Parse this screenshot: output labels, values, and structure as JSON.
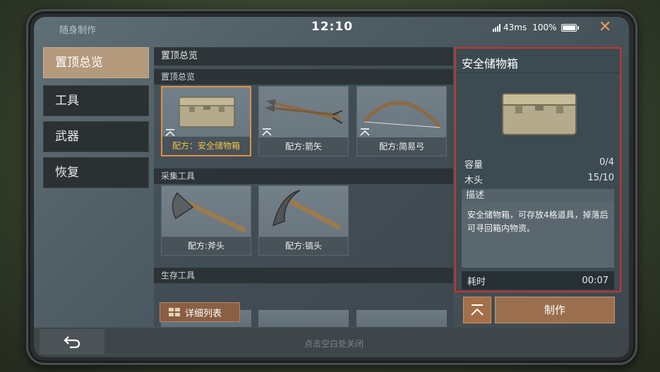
{
  "header": {
    "title": "随身制作",
    "clock": "12:10",
    "ping": "43ms",
    "battery": "100%",
    "close_icon": "close-icon"
  },
  "sidebar": {
    "items": [
      {
        "label": "置顶总览",
        "active": true
      },
      {
        "label": "工具"
      },
      {
        "label": "武器"
      },
      {
        "label": "恢复"
      }
    ]
  },
  "main": {
    "header": "置顶总览",
    "sections": [
      {
        "title": "置顶总览",
        "cards": [
          {
            "label": "配方：安全储物箱",
            "selected": true
          },
          {
            "label": "配方:箭矢"
          },
          {
            "label": "配方:简易弓"
          }
        ]
      },
      {
        "title": "采集工具",
        "cards": [
          {
            "label": "配方:斧头"
          },
          {
            "label": "配方:镐头"
          }
        ]
      },
      {
        "title": "生存工具"
      }
    ],
    "detail_list_button": "详细列表"
  },
  "detail": {
    "name": "安全储物箱",
    "capacity_label": "容量",
    "capacity_value": "0/4",
    "wood_label": "木头",
    "wood_value": "15/10",
    "desc_header": "描述",
    "desc_text": "安全储物箱，可存放4格道具，掉落后可寻回箱内物资。",
    "time_label": "耗时",
    "time_value": "00:07",
    "make_button": "制作"
  },
  "footer": {
    "hint": "点击空白处关闭"
  },
  "colors": {
    "accent": "#e0913f",
    "highlight_border": "#d0312b",
    "selected_text": "#f0c14a"
  }
}
